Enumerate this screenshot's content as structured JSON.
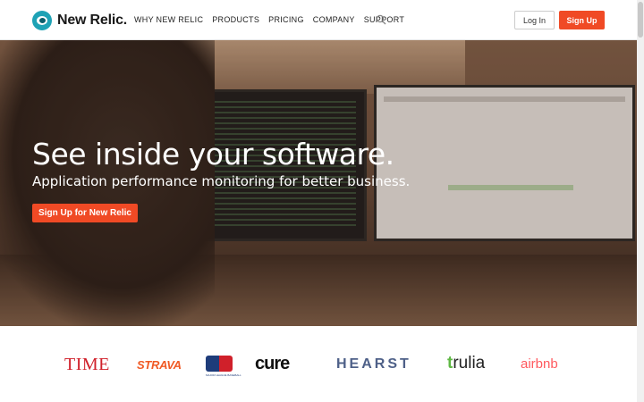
{
  "header": {
    "logo_text": "New Relic.",
    "nav": [
      "WHY NEW RELIC",
      "PRODUCTS",
      "PRICING",
      "COMPANY",
      "SUPPORT"
    ],
    "login_label": "Log In",
    "signup_label": "Sign Up"
  },
  "hero": {
    "title": "See inside your software.",
    "subtitle": "Application performance monitoring for better business.",
    "cta_label": "Sign Up for New Relic"
  },
  "customers": {
    "time": "TIME",
    "strava": "STRAVA",
    "mlb_text": "MAJOR LEAGUE BASEBALL",
    "cure": "cure",
    "hearst": "HEARST",
    "trulia_t": "t",
    "trulia_rest": "rulia",
    "airbnb": "airbnb"
  },
  "colors": {
    "accent": "#f04a25",
    "logo_teal": "#1ea2b5"
  }
}
